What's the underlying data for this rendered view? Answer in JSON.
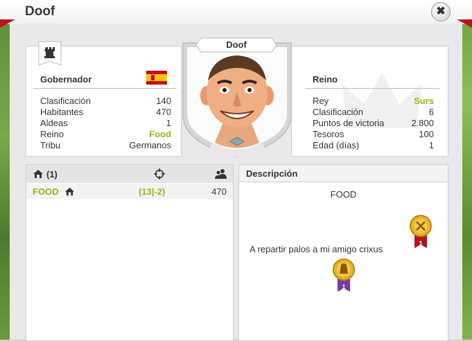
{
  "window": {
    "title": "Doof",
    "close_symbol": "✖"
  },
  "player": {
    "name": "Doof",
    "section_title": "Gobernador",
    "stats": [
      {
        "label": "Clasificación",
        "value": "140",
        "highlight": false
      },
      {
        "label": "Habitantes",
        "value": "470",
        "highlight": false
      },
      {
        "label": "Aldeas",
        "value": "1",
        "highlight": false
      },
      {
        "label": "Reino",
        "value": "Food",
        "highlight": true
      },
      {
        "label": "Tribu",
        "value": "Germanos",
        "highlight": false
      }
    ]
  },
  "kingdom": {
    "section_title": "Reino",
    "stats": [
      {
        "label": "Rey",
        "value": "Surs",
        "highlight": true
      },
      {
        "label": "Clasificación",
        "value": "6",
        "highlight": false
      },
      {
        "label": "Puntos de victoria",
        "value": "2.800",
        "highlight": false
      },
      {
        "label": "Tesoros",
        "value": "100",
        "highlight": false
      },
      {
        "label": "Edad (días)",
        "value": "1",
        "highlight": false
      }
    ]
  },
  "villages": {
    "header_count": "(1)",
    "rows": [
      {
        "name": "FOOD",
        "coords": "(13|-2)",
        "population": "470"
      }
    ]
  },
  "description": {
    "title": "Descripción",
    "line1": "FOOD",
    "line2": "A repartir palos a mi amigo crixus",
    "medals": [
      {
        "rank": "1",
        "ribbon": "#b3141c"
      },
      {
        "rank": "1",
        "ribbon": "#7b3aa0"
      }
    ]
  },
  "colors": {
    "accent_green": "#99b518",
    "brand_red": "#b8161b"
  }
}
